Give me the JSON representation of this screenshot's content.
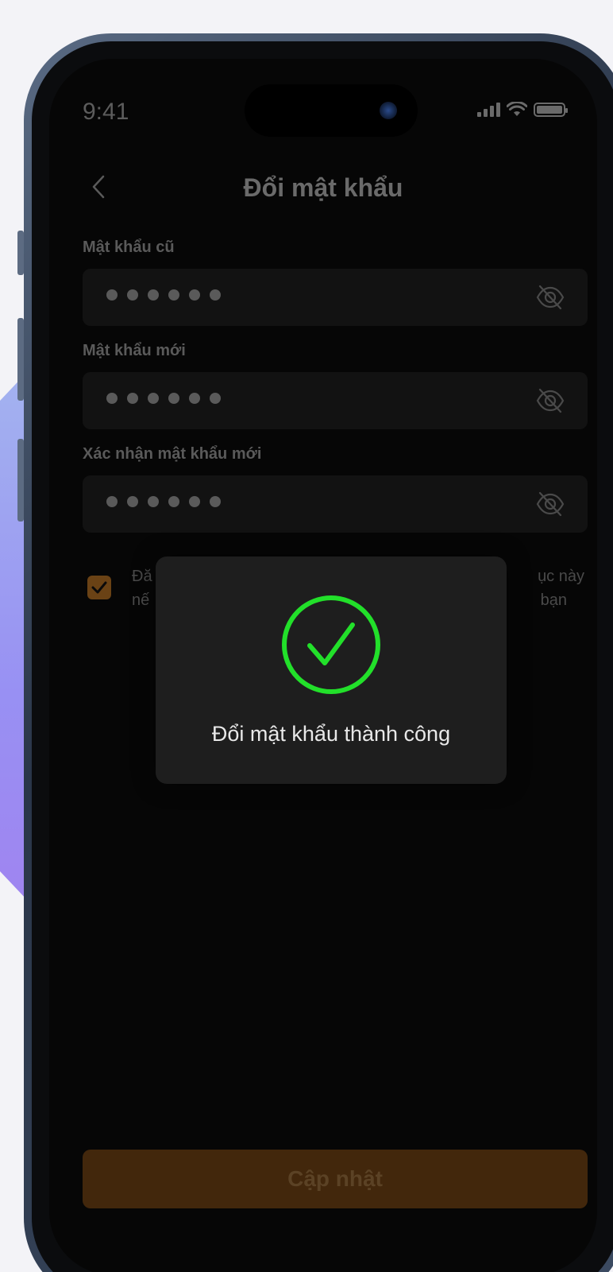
{
  "status_bar": {
    "time": "9:41"
  },
  "nav": {
    "title": "Đổi mật khẩu"
  },
  "form": {
    "old_password": {
      "label": "Mật khẩu cũ",
      "masked_value": "••••••"
    },
    "new_password": {
      "label": "Mật khẩu mới",
      "masked_value": "••••••"
    },
    "confirm_password": {
      "label": "Xác nhận mật khẩu mới",
      "masked_value": "••••••"
    },
    "checkbox": {
      "checked": true,
      "text_line1": "Đă",
      "text_line1_end": "ục này",
      "text_line2": "nế",
      "text_line2_end": "bạn"
    }
  },
  "toast": {
    "message": "Đổi mật khẩu thành công",
    "icon": "check-circle-icon",
    "color": "#22e02a"
  },
  "footer": {
    "update_label": "Cập nhật"
  },
  "colors": {
    "accent": "#6a4215",
    "background": "#060606",
    "field_background": "#121212"
  }
}
